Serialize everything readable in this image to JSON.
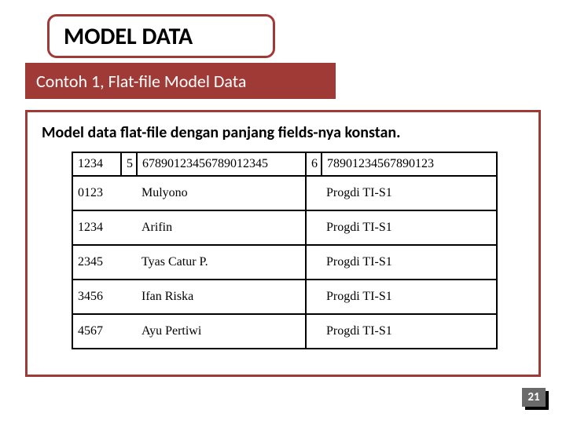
{
  "title": "MODEL DATA",
  "subtitle": "Contoh 1, Flat-file Model Data",
  "caption": "Model data flat-file dengan panjang fields-nya konstan.",
  "header": {
    "c1": "1234",
    "c2": "5",
    "c3": "67890123456789012345",
    "c4": "6",
    "c5": "78901234567890123"
  },
  "rows": [
    {
      "id": "0123",
      "name": "Mulyono",
      "prog": "Progdi TI-S1"
    },
    {
      "id": "1234",
      "name": "Arifin",
      "prog": "Progdi TI-S1"
    },
    {
      "id": "2345",
      "name": "Tyas Catur P.",
      "prog": "Progdi TI-S1"
    },
    {
      "id": "3456",
      "name": "Ifan Riska",
      "prog": "Progdi TI-S1"
    },
    {
      "id": "4567",
      "name": "Ayu Pertiwi",
      "prog": "Progdi TI-S1"
    }
  ],
  "page_number": "21",
  "chart_data": {
    "type": "table",
    "title": "Model data flat-file dengan panjang fields-nya konstan.",
    "columns_ruler": [
      "1234",
      "5",
      "67890123456789012345",
      "6",
      "78901234567890123"
    ],
    "records": [
      {
        "id": "0123",
        "name": "Mulyono",
        "program": "Progdi TI-S1"
      },
      {
        "id": "1234",
        "name": "Arifin",
        "program": "Progdi TI-S1"
      },
      {
        "id": "2345",
        "name": "Tyas Catur P.",
        "program": "Progdi TI-S1"
      },
      {
        "id": "3456",
        "name": "Ifan Riska",
        "program": "Progdi TI-S1"
      },
      {
        "id": "4567",
        "name": "Ayu Pertiwi",
        "program": "Progdi TI-S1"
      }
    ]
  }
}
